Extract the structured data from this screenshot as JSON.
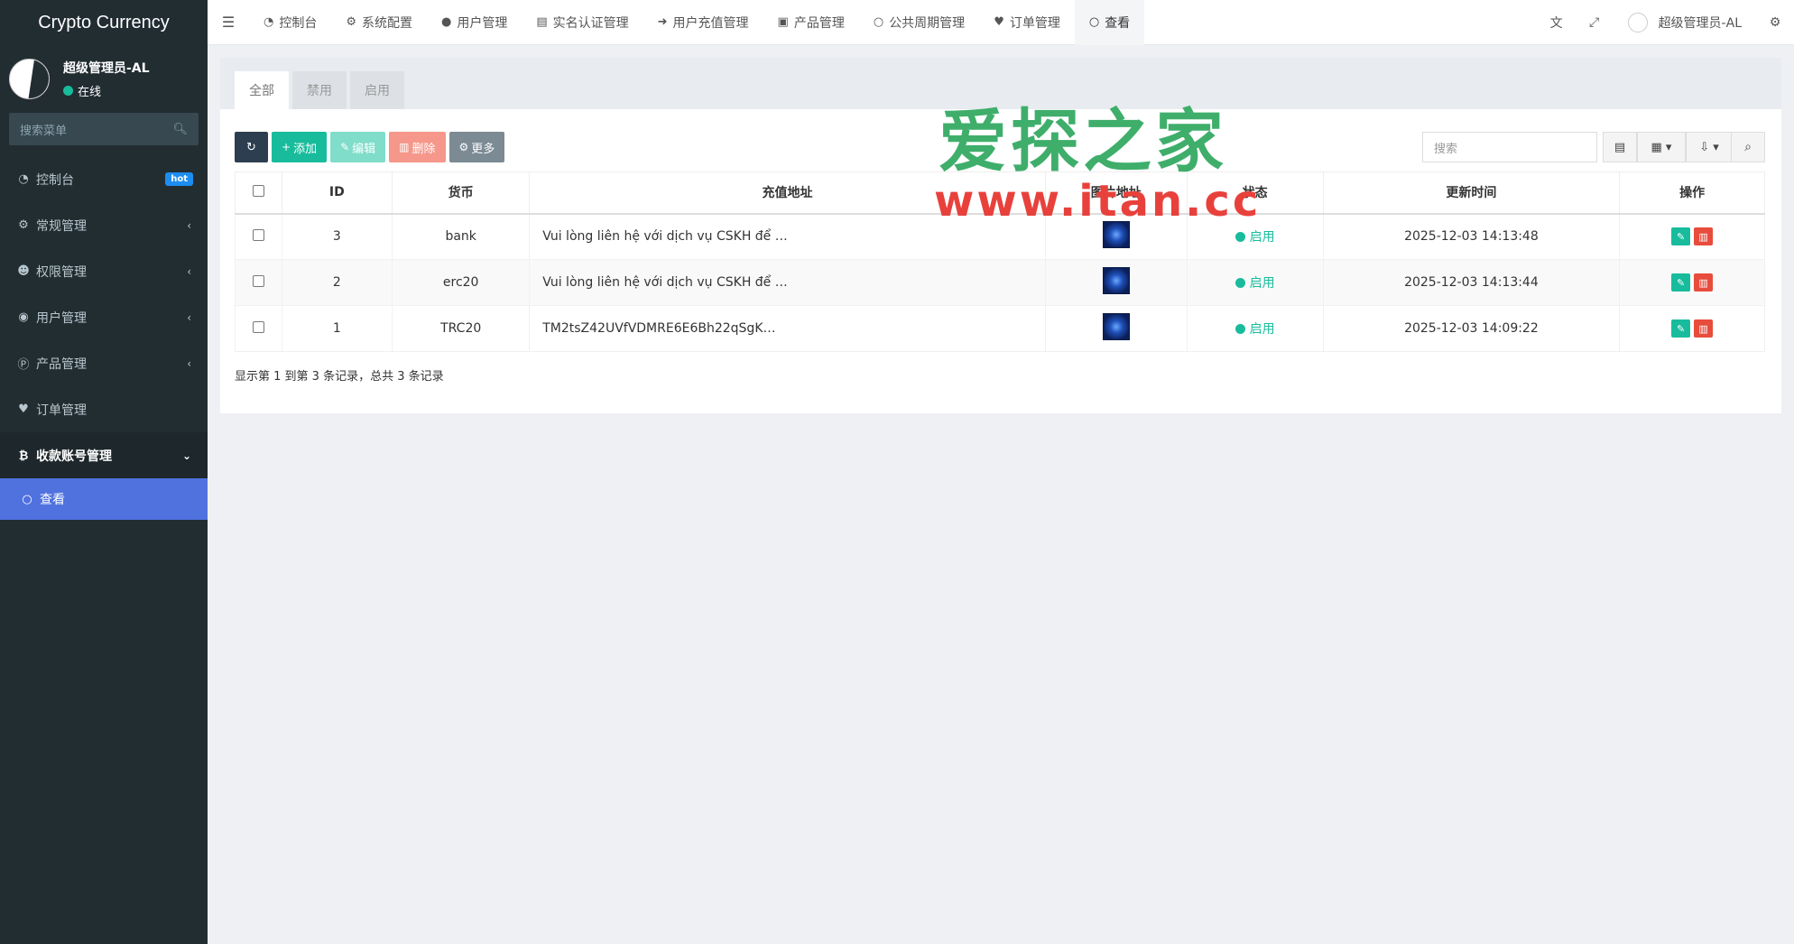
{
  "app": {
    "title": "Crypto Currency"
  },
  "sidebar": {
    "user": {
      "name": "超级管理员-AL",
      "status": "在线"
    },
    "search_placeholder": "搜索菜单",
    "items": [
      {
        "label": "控制台",
        "icon": "dashboard-icon",
        "badge": "hot"
      },
      {
        "label": "常规管理",
        "icon": "cogs-icon",
        "arrow": "‹"
      },
      {
        "label": "权限管理",
        "icon": "group-icon",
        "arrow": "‹"
      },
      {
        "label": "用户管理",
        "icon": "user-circle-icon",
        "arrow": "‹"
      },
      {
        "label": "产品管理",
        "icon": "product-icon",
        "arrow": "‹"
      },
      {
        "label": "订单管理",
        "icon": "heartbeat-icon"
      },
      {
        "label": "收款账号管理",
        "icon": "bitcoin-icon",
        "arrow": "⌄"
      },
      {
        "label": "查看",
        "icon": "circle-o-icon"
      }
    ]
  },
  "navbar": {
    "tabs": [
      {
        "label": "控制台",
        "icon": "dashboard-icon"
      },
      {
        "label": "系统配置",
        "icon": "gear-icon"
      },
      {
        "label": "用户管理",
        "icon": "user-icon"
      },
      {
        "label": "实名认证管理",
        "icon": "id-card-icon"
      },
      {
        "label": "用户充值管理",
        "icon": "sign-in-icon"
      },
      {
        "label": "产品管理",
        "icon": "shopping-bag-icon"
      },
      {
        "label": "公共周期管理",
        "icon": "circle-o-icon"
      },
      {
        "label": "订单管理",
        "icon": "heartbeat-icon"
      },
      {
        "label": "查看",
        "icon": "circle-o-icon"
      }
    ],
    "user_name": "超级管理员-AL"
  },
  "panel": {
    "tabs": [
      "全部",
      "禁用",
      "启用"
    ],
    "toolbar": {
      "add": "添加",
      "edit": "编辑",
      "delete": "删除",
      "more": "更多"
    },
    "search_placeholder": "搜索",
    "table": {
      "headers": [
        "ID",
        "货币",
        "充值地址",
        "图片地址",
        "状态",
        "更新时间",
        "操作"
      ],
      "rows": [
        {
          "id": "3",
          "currency": "bank",
          "address": "Vui lòng liên hệ với dịch vụ CSKH để …",
          "status": "启用",
          "updated": "2025-12-03 14:13:48"
        },
        {
          "id": "2",
          "currency": "erc20",
          "address": "Vui lòng liên hệ với dịch vụ CSKH để …",
          "status": "启用",
          "updated": "2025-12-03 14:13:44"
        },
        {
          "id": "1",
          "currency": "TRC20",
          "address": "TM2tsZ42UVfVDMRE6E6Bh22qSgK…",
          "status": "启用",
          "updated": "2025-12-03 14:09:22"
        }
      ]
    },
    "footer": "显示第 1 到第 3 条记录，总共 3 条记录"
  },
  "watermark": {
    "title": "爱探之家",
    "url": "www.itan.cc"
  },
  "colors": {
    "sidebar": "#222d32",
    "active": "#4f72de",
    "success": "#18bc9c",
    "danger": "#e74c3c"
  }
}
